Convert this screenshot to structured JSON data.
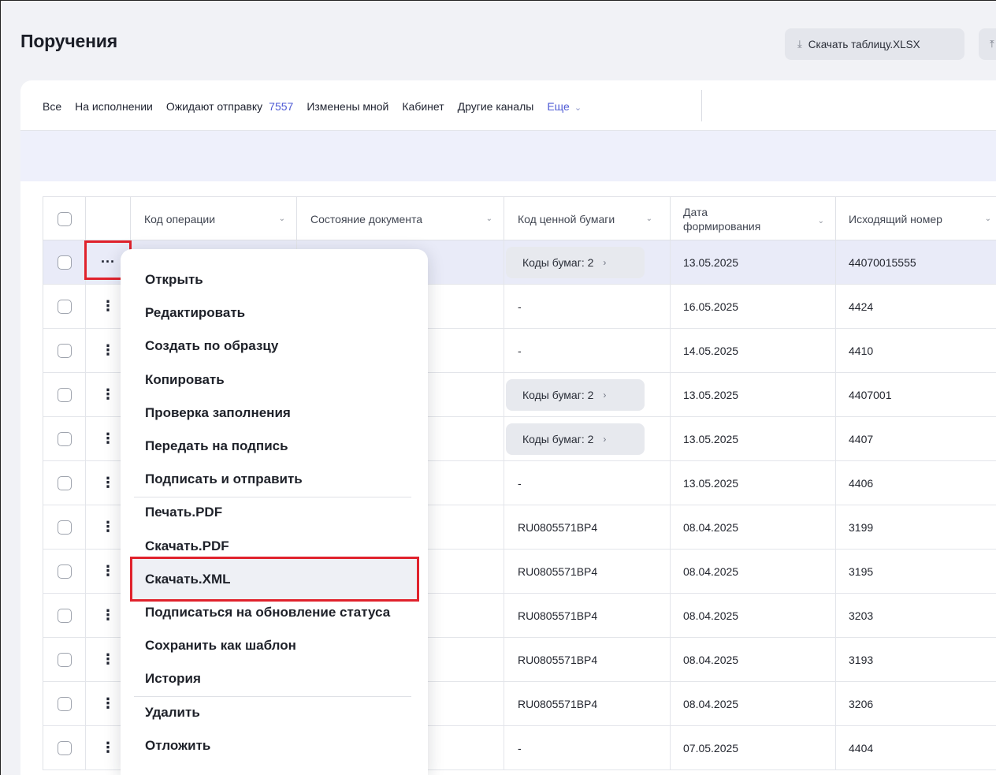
{
  "page": {
    "title": "Поручения"
  },
  "toolbar": {
    "download_xlsx_label": "Скачать таблицу.XLSX"
  },
  "tabs": [
    {
      "label": "Все",
      "active": true
    },
    {
      "label": "На исполнении"
    },
    {
      "label": "Ожидают отправку",
      "count": "7557"
    },
    {
      "label": "Изменены мной"
    },
    {
      "label": "Кабинет"
    },
    {
      "label": "Другие каналы"
    },
    {
      "label": "Еще"
    }
  ],
  "table": {
    "headers": {
      "operation_code": "Код операции",
      "document_state": "Состояние документа",
      "security_code": "Код ценной бумаги",
      "formation_date": "Дата формирования",
      "outgoing_number": "Исходящий номер"
    },
    "rows": [
      {
        "security_code": "Коды бумаг: 2",
        "date": "13.05.2025",
        "number": "44070015555",
        "selected": true
      },
      {
        "security_code": "-",
        "date": "16.05.2025",
        "number": "4424"
      },
      {
        "security_code": "-",
        "date": "14.05.2025",
        "number": "4410"
      },
      {
        "security_code": "Коды бумаг: 2",
        "date": "13.05.2025",
        "number": "4407001"
      },
      {
        "security_code": "Коды бумаг: 2",
        "date": "13.05.2025",
        "number": "4407"
      },
      {
        "security_code": "-",
        "date": "13.05.2025",
        "number": "4406"
      },
      {
        "security_code": "RU0805571BP4",
        "date": "08.04.2025",
        "number": "3199"
      },
      {
        "security_code": "RU0805571BP4",
        "date": "08.04.2025",
        "number": "3195"
      },
      {
        "security_code": "RU0805571BP4",
        "date": "08.04.2025",
        "number": "3203"
      },
      {
        "security_code": "RU0805571BP4",
        "date": "08.04.2025",
        "number": "3193"
      },
      {
        "security_code": "RU0805571BP4",
        "date": "08.04.2025",
        "number": "3206"
      },
      {
        "security_code": "-",
        "date": "07.05.2025",
        "number": "4404"
      }
    ]
  },
  "context_menu": {
    "items": [
      "Открыть",
      "Редактировать",
      "Создать по образцу",
      "Копировать",
      "Проверка заполнения",
      "Передать на подпись",
      "Подписать и отправить",
      "Печать.PDF",
      "Скачать.PDF",
      "Скачать.XML",
      "Подписаться на обновление статуса",
      "Сохранить как шаблон",
      "История",
      "Удалить",
      "Отложить"
    ]
  },
  "icons": {
    "download": "download-icon",
    "upload": "upload-icon",
    "chevron": "chevron-down-icon",
    "row_actions": "more-vertical-icon",
    "row_actions_open": "more-horizontal-icon"
  },
  "colors": {
    "accent": "#4f5bd5",
    "highlight": "#e0222c",
    "selected_row": "#e9ebf8"
  }
}
